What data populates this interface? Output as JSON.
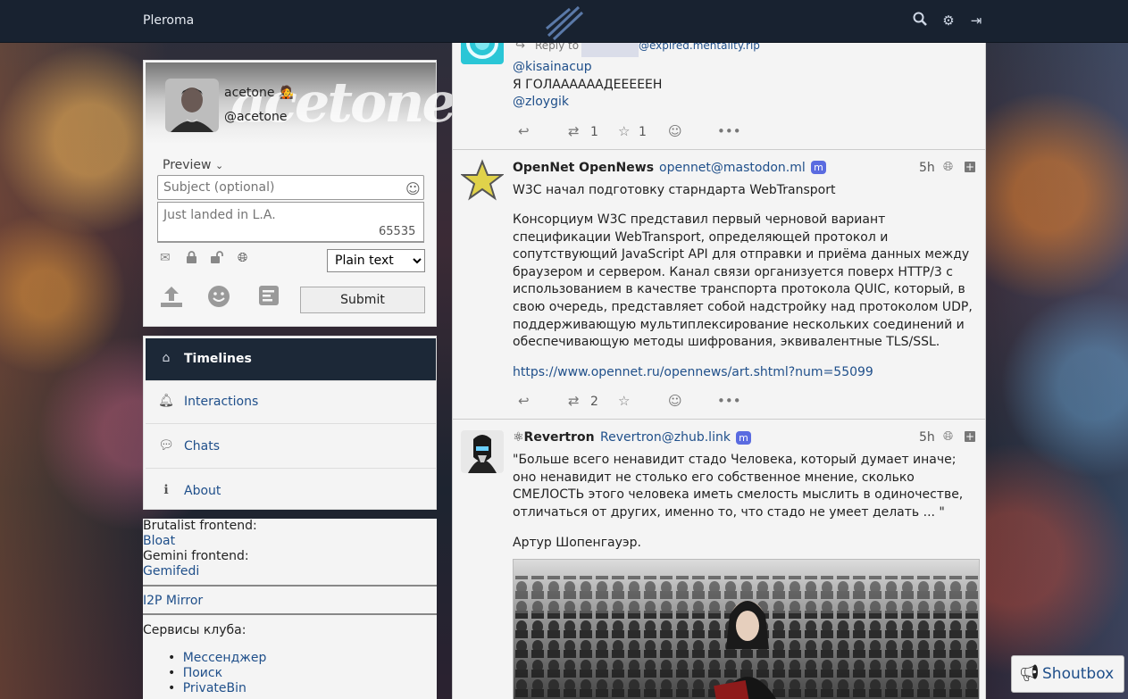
{
  "app": {
    "brand": "Pleroma"
  },
  "topbar": {
    "icons": [
      "search-icon",
      "gear-icon",
      "logout-icon"
    ]
  },
  "user": {
    "banner_text": "acetone",
    "name": "acetone 🧑‍🎤",
    "handle": "@acetone"
  },
  "composer": {
    "preview_label": "Preview",
    "subject_placeholder": "Subject (optional)",
    "status_placeholder": "Just landed in L.A.",
    "char_count": "65535",
    "format_value": "Plain text",
    "format_options": [
      "Plain text"
    ],
    "submit_label": "Submit"
  },
  "nav": {
    "items": [
      {
        "label": "Timelines",
        "icon": "home-icon"
      },
      {
        "label": "Interactions",
        "icon": "bell-icon"
      },
      {
        "label": "Chats",
        "icon": "comments-icon"
      },
      {
        "label": "About",
        "icon": "info-circle-icon"
      }
    ]
  },
  "info": {
    "brutalist_label": "Brutalist frontend:",
    "brutalist_link": "Bloat",
    "gemini_label": "Gemini frontend:",
    "gemini_link": "Gemifedi",
    "i2p_link": "I2P Mirror",
    "club_label": "Сервисы клуба:",
    "services": [
      "Мессенджер",
      "Поиск",
      "PrivateBin"
    ]
  },
  "posts": [
    {
      "reply_prefix": "Reply to",
      "reply_target": "@expired.mentality.rip",
      "lines": [
        "@kisainacup",
        "Я ГОЛААААААДЕЕЕЕЕН",
        "@zloygik"
      ],
      "retweets": "1",
      "favorites": "1"
    },
    {
      "name": "OpenNet OpenNews",
      "handle": "opennet@mastodon.ml",
      "time": "5h",
      "title": "W3C начал подготовку старндарта WebTransport",
      "body": "Консорциум W3C представил первый черновой вариант спецификации WebTransport, определяющей протокол и сопутствующий JavaScript API для отправки и приёма данных между браузером и сервером. Канал связи организуется поверх HTTP/3 с использованием в качестве транспорта протокола QUIC, который, в свою очередь, представляет собой надстройку над протоколом UDP, поддерживающую мультиплексирование нескольких соединений и обеспечивающую методы шифрования, эквивалентные TLS/SSL.",
      "link": "https://www.opennet.ru/opennews/art.shtml?num=55099",
      "retweets": "2"
    },
    {
      "name": "⚛Revertron",
      "handle": "Revertron@zhub.link",
      "time": "5h",
      "body": "\"Больше всего ненавидит стадо Человека, который думает иначе; оно ненавидит не столько его собственное мнение, сколько СМЕЛОСТЬ этого человека иметь смелость мыслить в одиночестве, отличаться от других, именно то, что стадо не умеет делать ... \"",
      "author": "Артур Шопенгауэр."
    }
  ],
  "shoutbox": {
    "label": "Shoutbox"
  }
}
